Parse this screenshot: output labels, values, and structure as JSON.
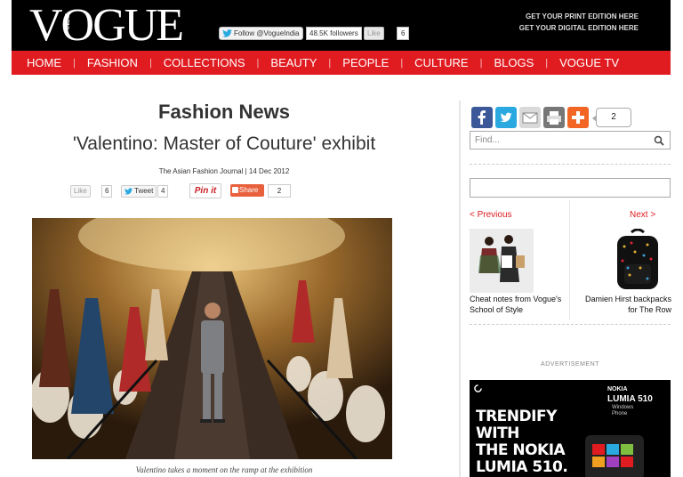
{
  "header": {
    "logo": "VOGUE",
    "logo_sub": "INDIA",
    "follow_label": "Follow @VogueIndia",
    "followers": "48.5K followers",
    "like_label": "Like",
    "like_count": "6",
    "print_edition": "GET YOUR PRINT EDITION HERE",
    "digital_edition": "GET YOUR DIGITAL EDITION HERE"
  },
  "nav": [
    "HOME",
    "FASHION",
    "COLLECTIONS",
    "BEAUTY",
    "PEOPLE",
    "CULTURE",
    "BLOGS",
    "VOGUE TV"
  ],
  "article": {
    "section": "Fashion News",
    "headline": "'Valentino: Master of Couture' exhibit",
    "byline": "The Asian Fashion Journal | 14 Dec 2012",
    "like_label": "Like",
    "like_count": "6",
    "tweet_label": "Tweet",
    "tweet_count": "4",
    "pin_label": "Pin it",
    "share_label": "Share",
    "share_count": "2",
    "caption": "Valentino takes a moment on the ramp at the exhibition"
  },
  "sidebar": {
    "share_count": "2",
    "find_placeholder": "Find...",
    "prev_label": "< Previous",
    "next_label": "Next >",
    "prev_caption": "Cheat notes from Vogue's School of Style",
    "next_caption": "Damien Hirst backpacks for The Row",
    "ad_label": "ADVERTISEMENT",
    "ad": {
      "brand_line1": "NOKIA",
      "brand_line2": "LUMIA 510",
      "platform": "Windows Phone",
      "line1": "TRENDIFY",
      "line2": "WITH",
      "line3": "THE NOKIA",
      "line4": "LUMIA 510."
    }
  },
  "colors": {
    "brand_red": "#e01c21",
    "header_bg": "#000000"
  }
}
